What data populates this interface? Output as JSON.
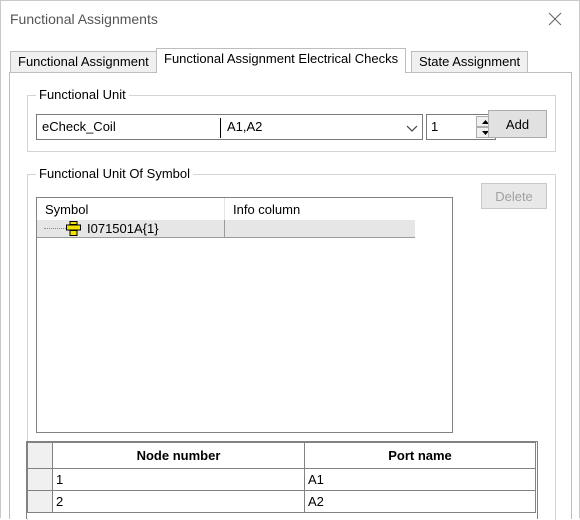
{
  "window": {
    "title": "Functional Assignments"
  },
  "tabs": [
    {
      "label": "Functional Assignment"
    },
    {
      "label": "Functional Assignment Electrical Checks"
    },
    {
      "label": "State Assignment"
    }
  ],
  "functional_unit": {
    "legend": "Functional Unit",
    "combo_name": "eCheck_Coil",
    "combo_ports": "A1,A2",
    "quantity": "1",
    "add_label": "Add"
  },
  "symbol_group": {
    "legend": "Functional Unit Of Symbol",
    "delete_label": "Delete",
    "columns": [
      "Symbol",
      "Info column"
    ],
    "rows": [
      {
        "symbol": "I071501A{1}",
        "info": ""
      }
    ]
  },
  "node_grid": {
    "columns": [
      "Node number",
      "Port name"
    ],
    "rows": [
      {
        "node": "1",
        "port": "A1"
      },
      {
        "node": "2",
        "port": "A2"
      }
    ]
  },
  "colors": {
    "symbol_icon": "#f2e200"
  }
}
